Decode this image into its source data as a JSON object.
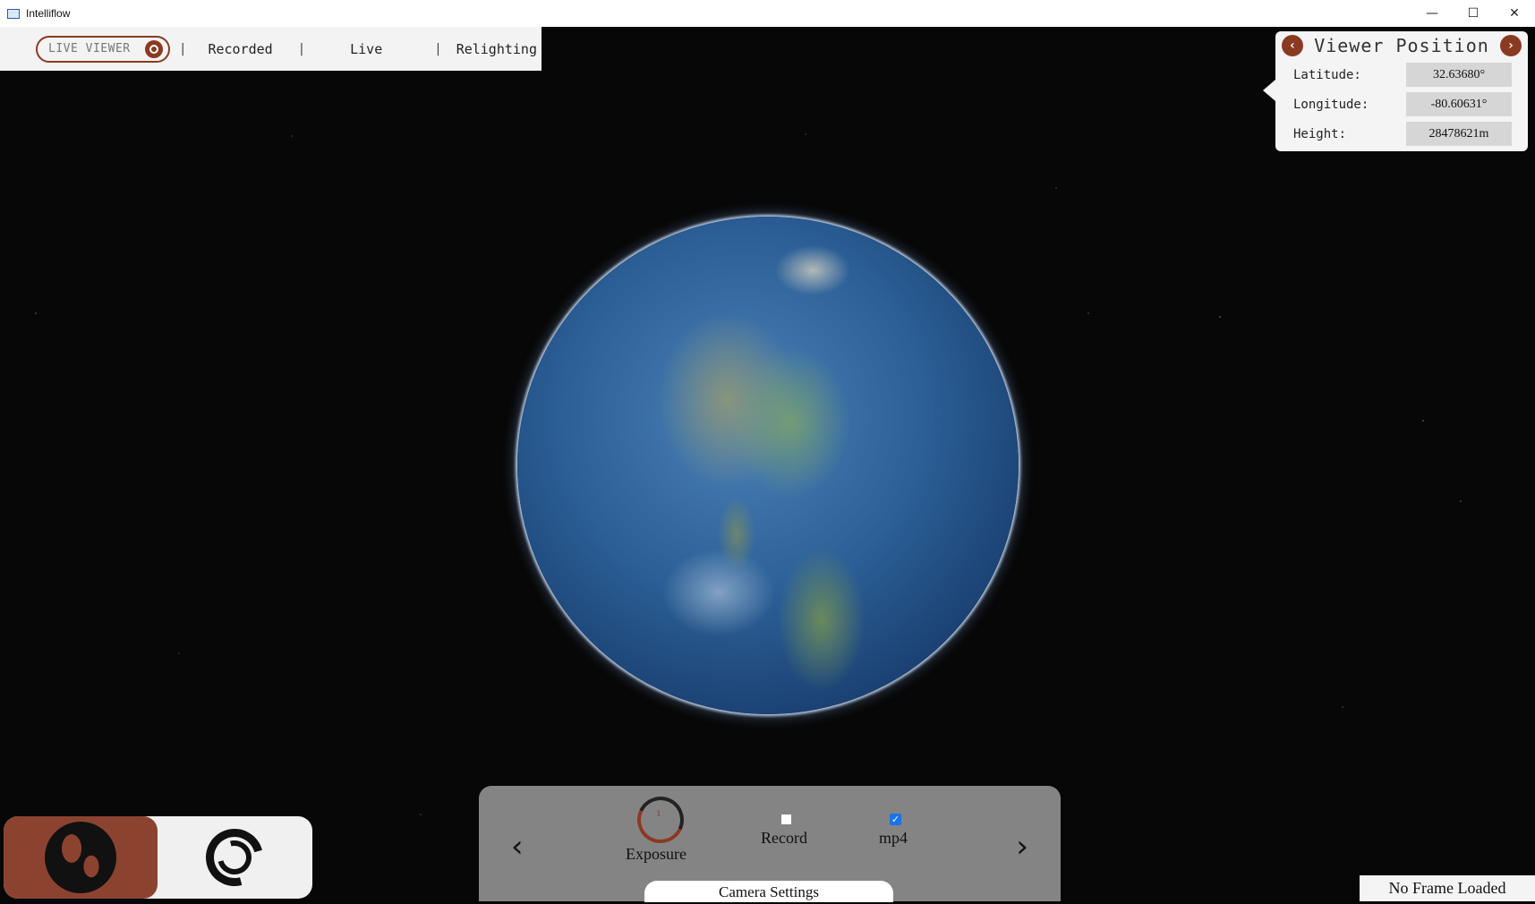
{
  "window": {
    "title": "Intelliflow",
    "controls": {
      "minimize": "—",
      "maximize": "☐",
      "close": "✕"
    }
  },
  "toolbar": {
    "live_viewer_label": "LIVE VIEWER",
    "separator": "|",
    "tabs": [
      "Recorded",
      "Live",
      "Relighting"
    ]
  },
  "viewer_position": {
    "title": "Viewer Position",
    "prev": "‹",
    "next": "›",
    "fields": [
      {
        "label": "Latitude:",
        "value": "32.63680°"
      },
      {
        "label": "Longitude:",
        "value": "-80.60631°"
      },
      {
        "label": "Height:",
        "value": "28478621m"
      }
    ]
  },
  "mode_switch": {
    "items": [
      {
        "icon": "globe-icon",
        "active": true
      },
      {
        "icon": "ring-icon",
        "active": false
      }
    ]
  },
  "camera_panel": {
    "prev": "‹",
    "next": "›",
    "exposure_label": "Exposure",
    "record_label": "Record",
    "record_checked": false,
    "mp4_label": "mp4",
    "mp4_checked": true,
    "tab_label": "Camera Settings"
  },
  "status": {
    "no_frame": "No Frame Loaded"
  },
  "colors": {
    "accent": "#8b3a22",
    "panel": "#f4f4f4",
    "space": "#070707"
  }
}
